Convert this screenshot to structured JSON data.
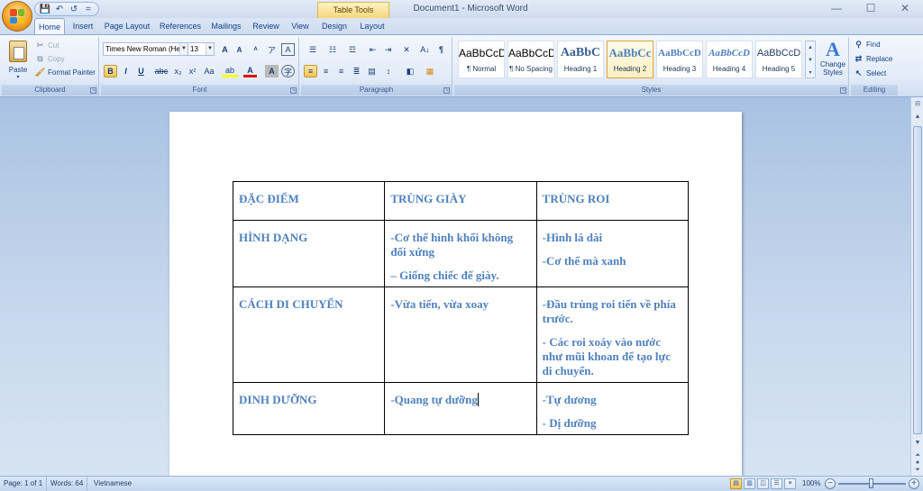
{
  "window": {
    "title": "Document1 - Microsoft Word",
    "context_tab_group": "Table Tools",
    "controls": [
      "—",
      "☐",
      "✕"
    ]
  },
  "qat": {
    "save": "💾",
    "undo": "↶",
    "redo": "↺",
    "customize": "="
  },
  "tabs": [
    "Home",
    "Insert",
    "Page Layout",
    "References",
    "Mailings",
    "Review",
    "View",
    "Design",
    "Layout"
  ],
  "active_tab": "Home",
  "ribbon": {
    "clipboard": {
      "label": "Clipboard",
      "paste": "Paste",
      "cut": "Cut",
      "copy": "Copy",
      "format_painter": "Format Painter"
    },
    "font": {
      "label": "Font",
      "font_name": "Times New Roman (He",
      "font_size": "13",
      "bold": "B",
      "italic": "I",
      "underline": "U",
      "strike": "abc",
      "subscript": "x₂",
      "superscript": "x²",
      "change_case": "Aa",
      "grow": "A",
      "shrink": "A",
      "clear": "ᴬ",
      "phonetic": "ア",
      "border_char": "A",
      "highlight": "ab",
      "font_color": "A",
      "shade_char": "A",
      "enclose": "字"
    },
    "paragraph": {
      "label": "Paragraph",
      "show_marks": "¶",
      "sort": "A↓"
    },
    "styles": {
      "label": "Styles",
      "items": [
        {
          "preview": "AaBbCcD",
          "name": "¶ Normal"
        },
        {
          "preview": "AaBbCcD",
          "name": "¶ No Spacing"
        },
        {
          "preview": "AaBbC",
          "name": "Heading 1"
        },
        {
          "preview": "AaBbCc",
          "name": "Heading 2"
        },
        {
          "preview": "AaBbCcD",
          "name": "Heading 3"
        },
        {
          "preview": "AaBbCcD",
          "name": "Heading 4"
        },
        {
          "preview": "AaBbCcD",
          "name": "Heading 5"
        }
      ],
      "selected_index": 3,
      "change_styles": "Change Styles"
    },
    "editing": {
      "label": "Editing",
      "find": "Find",
      "replace": "Replace",
      "select": "Select"
    }
  },
  "document": {
    "table": [
      [
        [
          "ĐẶC ĐIỂM"
        ],
        [
          "TRÙNG GIÀY"
        ],
        [
          "TRÙNG ROI"
        ]
      ],
      [
        [
          "HÌNH DẠNG"
        ],
        [
          "-Cơ thể hình khối không đối xứng",
          " – Giống chiếc đế giày."
        ],
        [
          "-Hình lá dài",
          "-Cơ thể mà xanh"
        ]
      ],
      [
        [
          "CÁCH DI CHUYỂN"
        ],
        [
          "-Vừa tiến, vừa xoay"
        ],
        [
          "-Đầu trùng roi tiến về phía trước.",
          "- Các roi xoáy vào nước như mũi khoan để tạo lực di chuyển."
        ]
      ],
      [
        [
          "DINH DƯỠNG"
        ],
        [
          "-Quang tự dưỡng"
        ],
        [
          "-Tự dương",
          "- Dị dưỡng"
        ]
      ]
    ]
  },
  "statusbar": {
    "page": "Page: 1 of 1",
    "words": "Words: 64",
    "language": "Vietnamese",
    "zoom": "100%"
  },
  "colors": {
    "ribbon": "#e2ebf7",
    "table_text": "#4f81bd",
    "workspace": "#c9d9ee"
  }
}
